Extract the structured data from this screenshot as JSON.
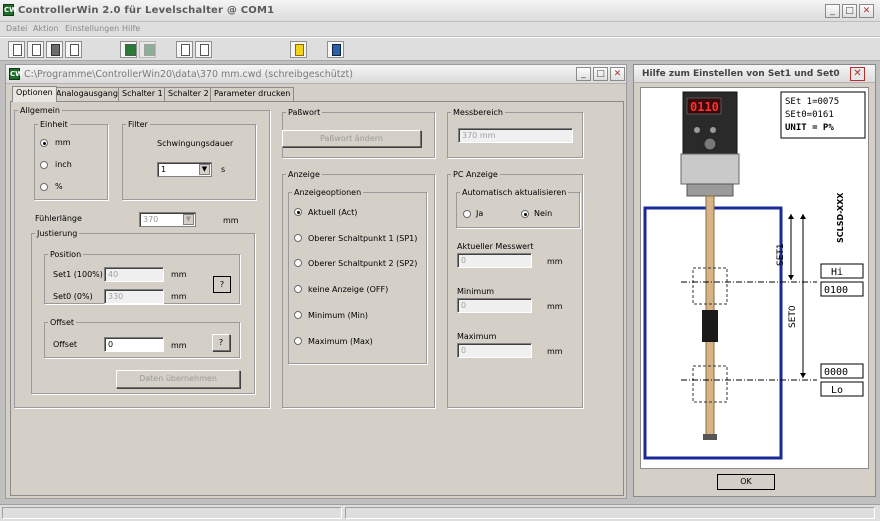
{
  "window": {
    "title": "ControllerWin 2.0  für  Levelschalter @ COM1",
    "app_icon": "controllerwin-icon"
  },
  "menu": [
    "Datei",
    "Aktion",
    "Einstellungen",
    "Hilfe"
  ],
  "toolbar": {
    "icons": [
      "new-file-icon",
      "open-file-icon",
      "save-icon",
      "print-icon",
      "connect-icon",
      "disconnect-icon",
      "upload-icon",
      "download-icon",
      "help-icon",
      "info-icon"
    ]
  },
  "doc": {
    "title": "C:\\Programme\\ControllerWin20\\data\\370 mm.cwd (schreibgeschützt)",
    "tabs": [
      "Optionen",
      "Analogausgang",
      "Schalter 1",
      "Schalter 2",
      "Parameter drucken"
    ],
    "active_tab": "Optionen",
    "allgemein": {
      "legend": "Allgemein",
      "einheit": {
        "legend": "Einheit",
        "options": [
          "mm",
          "inch",
          "%"
        ],
        "selected": "mm"
      },
      "filter": {
        "legend": "Filter",
        "label": "Schwingungsdauer",
        "value": "1",
        "unit": "s"
      },
      "fuehler_label": "Fühlerlänge",
      "fuehler_value": "370",
      "fuehler_unit": "mm",
      "justierung": {
        "legend": "Justierung",
        "position": {
          "legend": "Position",
          "set1_label": "Set1 (100%)",
          "set1_value": "40",
          "set1_unit": "mm",
          "set0_label": "Set0 (0%)",
          "set0_value": "330",
          "set0_unit": "mm",
          "help": "?"
        },
        "offset": {
          "legend": "Offset",
          "label": "Offset",
          "value": "0",
          "unit": "mm",
          "help": "?"
        },
        "apply_button": "Daten übernehmen"
      }
    },
    "passwort": {
      "legend": "Paßwort",
      "button": "Paßwort ändern"
    },
    "messbereich": {
      "legend": "Messbereich",
      "value": "370 mm"
    },
    "anzeige": {
      "legend": "Anzeige",
      "sub_legend": "Anzeigeoptionen",
      "options": [
        "Aktuell (Act)",
        "Oberer Schaltpunkt 1 (SP1)",
        "Oberer Schaltpunkt 2 (SP2)",
        "keine Anzeige (OFF)",
        "Minimum (Min)",
        "Maximum (Max)"
      ],
      "selected": "Aktuell (Act)"
    },
    "pc_anzeige": {
      "legend": "PC Anzeige",
      "auto": {
        "legend": "Automatisch aktualisieren",
        "ja": "Ja",
        "nein": "Nein",
        "selected": "Nein"
      },
      "aktuell_label": "Aktueller Messwert",
      "aktuell_value": "0",
      "aktuell_unit": "mm",
      "min_label": "Minimum",
      "min_value": "0",
      "min_unit": "mm",
      "max_label": "Maximum",
      "max_value": "0",
      "max_unit": "mm"
    }
  },
  "help": {
    "title": "Hilfe zum Einstellen von Set1 und Set0",
    "device_display": "0110",
    "legend_lines": [
      "SEt 1=0075",
      "SEt0=0161",
      "UNIT = P%"
    ],
    "model": "SCLSD-XXX",
    "set1": "SET1",
    "set0": "SET0",
    "lcd_hi": "Hi",
    "lcd_100": "0100",
    "lcd_000": "0000",
    "lcd_lo": "Lo",
    "ok": "OK"
  },
  "colors": {
    "accent": "#0a246a",
    "field_bg": "#ffffff",
    "dialog": "#d4d0c8",
    "tank_border": "#1a2a9a"
  }
}
